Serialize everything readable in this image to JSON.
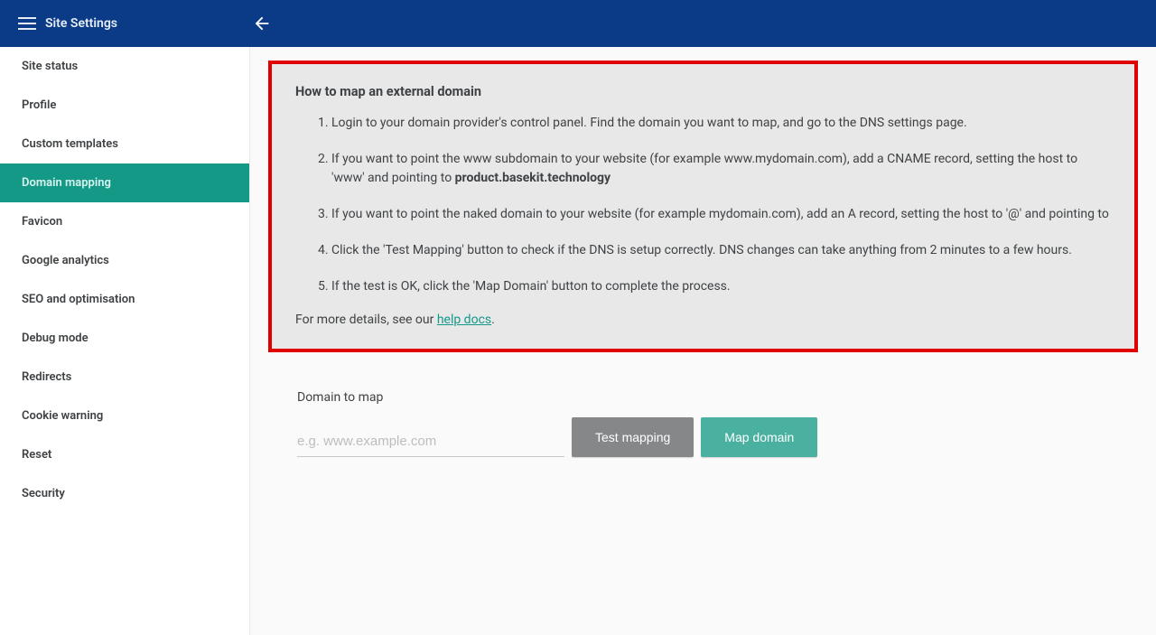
{
  "topbar": {
    "title": "Site Settings"
  },
  "sidebar": {
    "items": [
      {
        "label": "Site status"
      },
      {
        "label": "Profile"
      },
      {
        "label": "Custom templates"
      },
      {
        "label": "Domain mapping"
      },
      {
        "label": "Favicon"
      },
      {
        "label": "Google analytics"
      },
      {
        "label": "SEO and optimisation"
      },
      {
        "label": "Debug mode"
      },
      {
        "label": "Redirects"
      },
      {
        "label": "Cookie warning"
      },
      {
        "label": "Reset"
      },
      {
        "label": "Security"
      }
    ],
    "active_index": 3
  },
  "info": {
    "heading": "How to map an external domain",
    "step1": "Login to your domain provider's control panel. Find the domain you want to map, and go to the DNS settings page.",
    "step2_a": "If you want to point the www subdomain to your website (for example www.mydomain.com), add a CNAME record, setting the host to 'www' and pointing to ",
    "step2_strong": "product.basekit.technology",
    "step3": "If you want to point the naked domain to your website (for example mydomain.com), add an A record, setting the host to '@' and pointing to",
    "step4": "Click the 'Test Mapping' button to check if the DNS is setup correctly. DNS changes can take anything from 2 minutes to a few hours.",
    "step5": "If the test is OK, click the 'Map Domain' button to complete the process.",
    "more_prefix": "For more details, see our ",
    "more_link": "help docs",
    "more_suffix": "."
  },
  "form": {
    "label": "Domain to map",
    "placeholder": "e.g. www.example.com",
    "test_btn": "Test mapping",
    "map_btn": "Map domain"
  }
}
